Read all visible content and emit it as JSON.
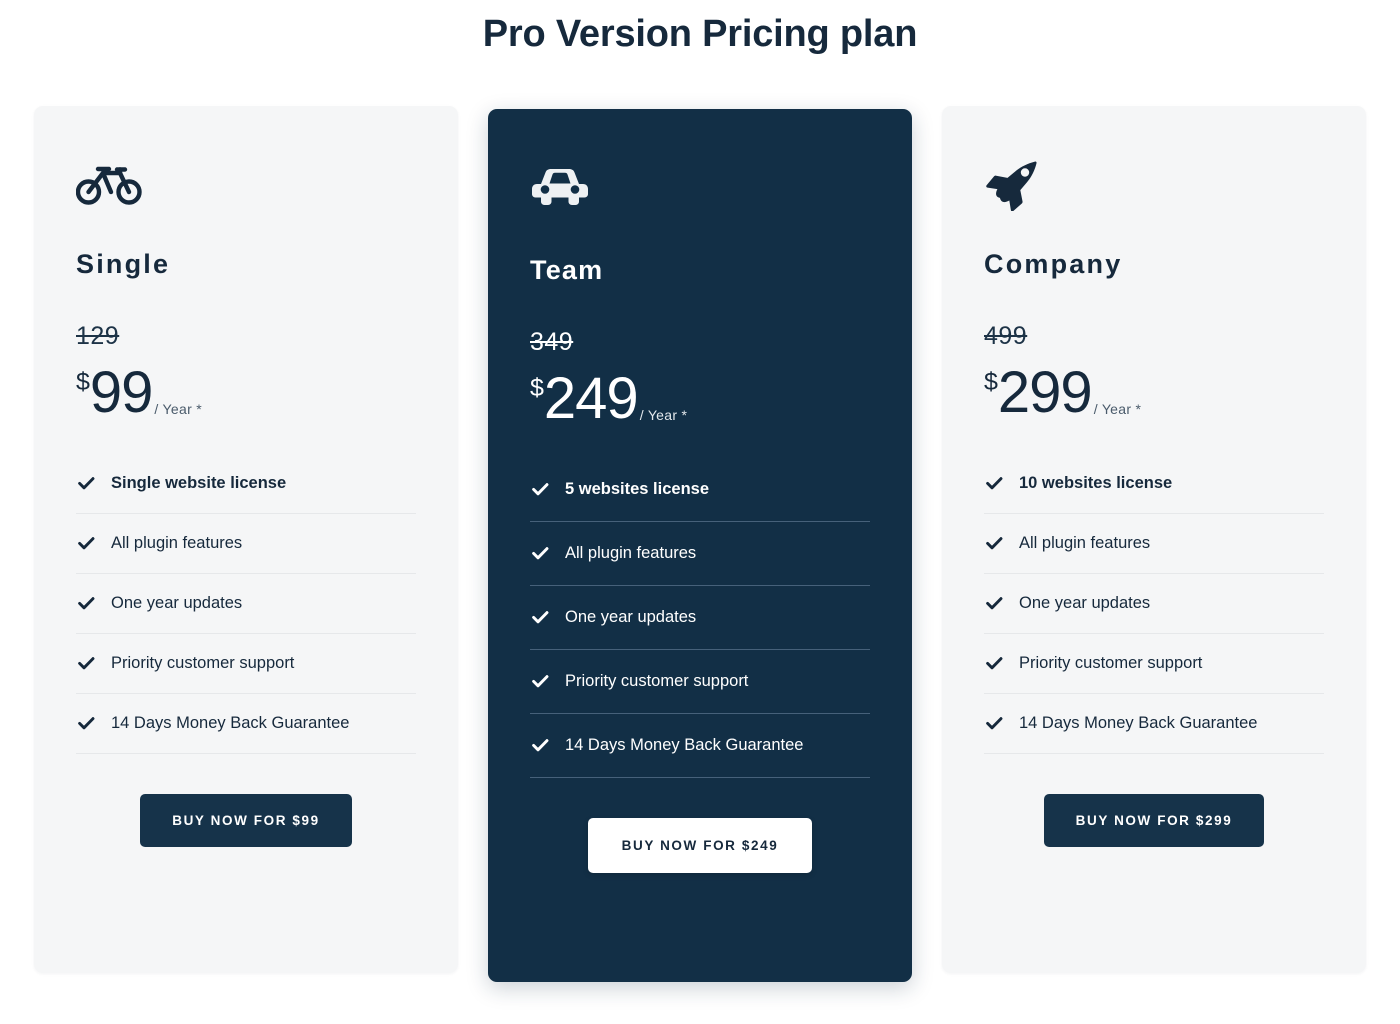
{
  "header": {
    "title": "Pro Version Pricing plan"
  },
  "colors": {
    "page_background": "#ffffff",
    "card_light_background": "#f5f6f7",
    "card_dark_background": "#122f46",
    "accent_navy": "#16293c",
    "divider_light": "#e6e8ea",
    "divider_dark": "#46617a"
  },
  "plans": [
    {
      "id": "single",
      "icon": "bicycle-icon",
      "name": "Single",
      "price_old": "129",
      "currency": "$",
      "price": "99",
      "period": "/ Year *",
      "highlighted": false,
      "features": [
        "Single website license",
        "All plugin features",
        "One year updates",
        "Priority customer support",
        "14 Days Money Back Guarantee"
      ],
      "cta_label": "Buy now for $99"
    },
    {
      "id": "team",
      "icon": "car-icon",
      "name": "Team",
      "price_old": "349",
      "currency": "$",
      "price": "249",
      "period": "/ Year *",
      "highlighted": true,
      "features": [
        "5 websites license",
        "All plugin features",
        "One year updates",
        "Priority customer support",
        "14 Days Money Back Guarantee"
      ],
      "cta_label": "Buy now for $249"
    },
    {
      "id": "company",
      "icon": "rocket-icon",
      "name": "Company",
      "price_old": "499",
      "currency": "$",
      "price": "299",
      "period": "/ Year *",
      "highlighted": false,
      "features": [
        "10 websites license",
        "All plugin features",
        "One year updates",
        "Priority customer support",
        "14 Days Money Back Guarantee"
      ],
      "cta_label": "Buy now for $299"
    }
  ]
}
